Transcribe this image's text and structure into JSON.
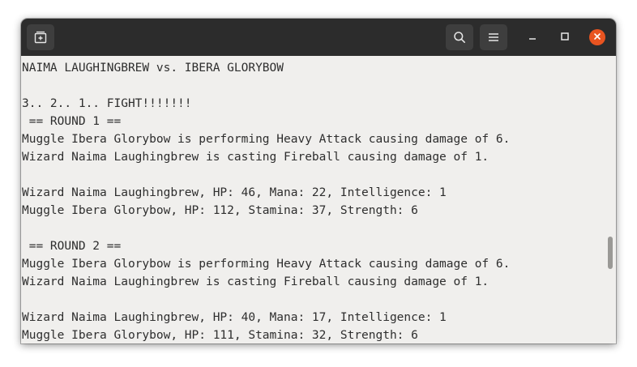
{
  "window": {
    "titlebar": {
      "new_tab_icon": "new-tab-icon",
      "search_icon": "search-icon",
      "menu_icon": "hamburger-menu-icon",
      "minimize_icon": "minimize-icon",
      "maximize_icon": "maximize-icon",
      "close_icon": "close-icon"
    },
    "colors": {
      "titlebar_bg": "#2c2c2c",
      "terminal_bg": "#f0efed",
      "terminal_text": "#2e2e2e",
      "close_accent": "#e95420"
    }
  },
  "terminal": {
    "lines": [
      "NAIMA LAUGHINGBREW vs. IBERA GLORYBOW",
      "",
      "3.. 2.. 1.. FIGHT!!!!!!!",
      " == ROUND 1 ==",
      "Muggle Ibera Glorybow is performing Heavy Attack causing damage of 6.",
      "Wizard Naima Laughingbrew is casting Fireball causing damage of 1.",
      "",
      "Wizard Naima Laughingbrew, HP: 46, Mana: 22, Intelligence: 1",
      "Muggle Ibera Glorybow, HP: 112, Stamina: 37, Strength: 6",
      "",
      " == ROUND 2 ==",
      "Muggle Ibera Glorybow is performing Heavy Attack causing damage of 6.",
      "Wizard Naima Laughingbrew is casting Fireball causing damage of 1.",
      "",
      "Wizard Naima Laughingbrew, HP: 40, Mana: 17, Intelligence: 1",
      "Muggle Ibera Glorybow, HP: 111, Stamina: 32, Strength: 6"
    ]
  }
}
